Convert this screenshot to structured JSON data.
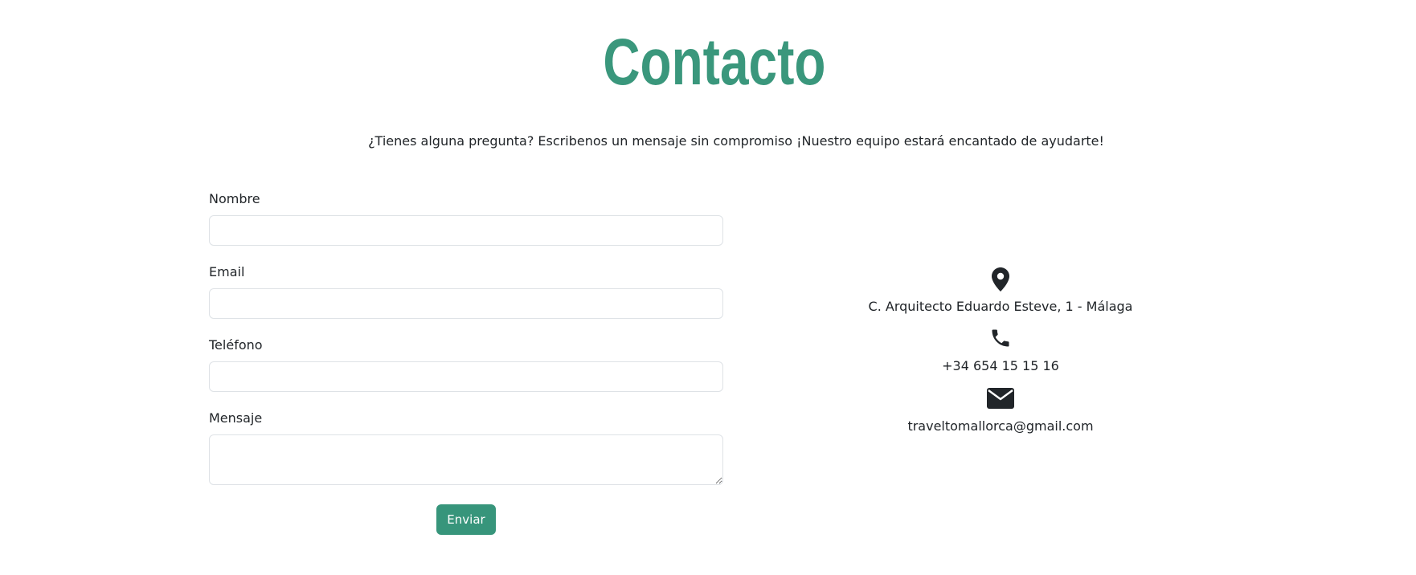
{
  "header": {
    "title": "Contacto",
    "subtitle": "¿Tienes alguna pregunta? Escribenos un mensaje sin compromiso ¡Nuestro equipo estará encantado de ayudarte!"
  },
  "form": {
    "fields": [
      {
        "label": "Nombre",
        "value": ""
      },
      {
        "label": "Email",
        "value": ""
      },
      {
        "label": "Teléfono",
        "value": ""
      },
      {
        "label": "Mensaje",
        "value": ""
      }
    ],
    "submit_label": "Enviar"
  },
  "contact": {
    "address": "C. Arquitecto Eduardo Esteve, 1 - Málaga",
    "address_icon": "map-marker-icon",
    "phone": "+34 654 15 15 16",
    "phone_icon": "phone-icon",
    "email": "traveltomallorca@gmail.com",
    "email_icon": "envelope-icon"
  },
  "colors": {
    "accent": "#3a977c",
    "button": "#37957b",
    "text": "#212529",
    "border": "#dee2e6"
  }
}
